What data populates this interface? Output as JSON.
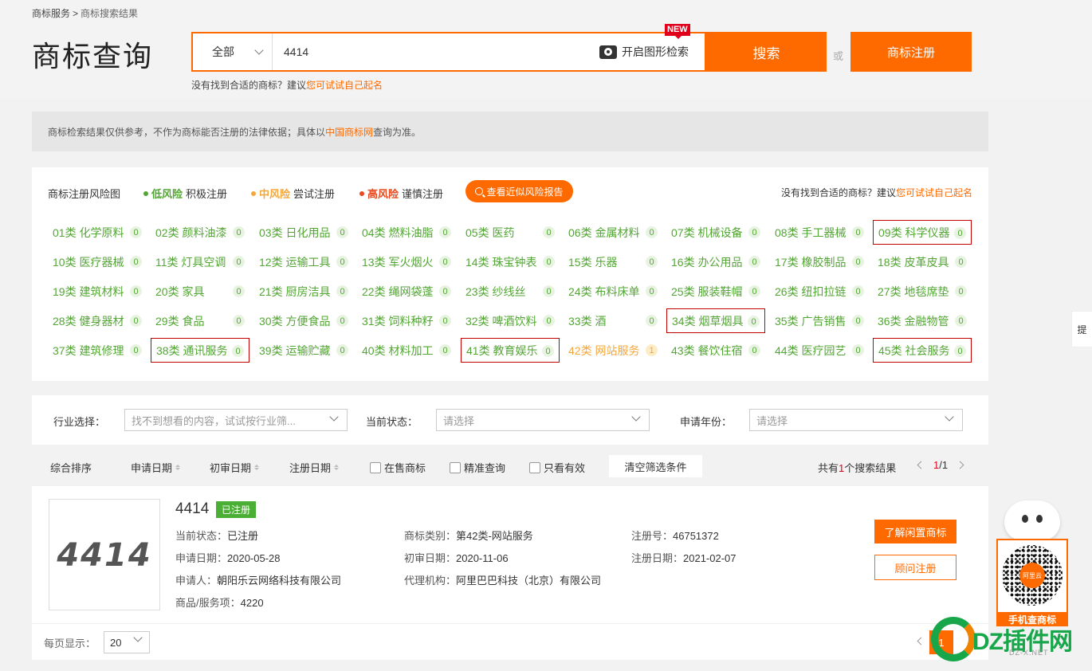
{
  "breadcrumb": {
    "root": "商标服务",
    "sep": ">",
    "current": "商标搜索结果"
  },
  "page_title": "商标查询",
  "search": {
    "scope": "全部",
    "query": "4414",
    "image_search_label": "开启图形检索",
    "new_badge": "NEW",
    "search_button": "搜索",
    "or_text": "或",
    "register_button": "商标注册"
  },
  "suggest": {
    "prefix": "没有找到合适的商标？建议",
    "link": "您可试试自己起名"
  },
  "notice": {
    "text1": "商标检索结果仅供参考，不作为商标能否注册的法律依据；具体以",
    "link": "中国商标网",
    "text2": "查询为准。"
  },
  "risk": {
    "title": "商标注册风险图",
    "low_label": "低风险",
    "low_desc": "积极注册",
    "mid_label": "中风险",
    "mid_desc": "尝试注册",
    "high_label": "高风险",
    "high_desc": "谨慎注册",
    "report_button": "查看近似风险报告",
    "suggest_prefix": "没有找到合适的商标？建议",
    "suggest_link": "您可试试自己起名",
    "colors": {
      "low": "#52a633",
      "mid": "#f3a73d",
      "high": "#e8491d"
    }
  },
  "classes": [
    {
      "label": "01类 化学原料",
      "count": "0"
    },
    {
      "label": "02类 颜料油漆",
      "count": "0"
    },
    {
      "label": "03类 日化用品",
      "count": "0"
    },
    {
      "label": "04类 燃料油脂",
      "count": "0"
    },
    {
      "label": "05类 医药",
      "count": "0"
    },
    {
      "label": "06类 金属材料",
      "count": "0"
    },
    {
      "label": "07类 机械设备",
      "count": "0"
    },
    {
      "label": "08类 手工器械",
      "count": "0"
    },
    {
      "label": "09类 科学仪器",
      "count": "0"
    },
    {
      "label": "10类 医疗器械",
      "count": "0"
    },
    {
      "label": "11类 灯具空调",
      "count": "0"
    },
    {
      "label": "12类 运输工具",
      "count": "0"
    },
    {
      "label": "13类 军火烟火",
      "count": "0"
    },
    {
      "label": "14类 珠宝钟表",
      "count": "0"
    },
    {
      "label": "15类 乐器",
      "count": "0"
    },
    {
      "label": "16类 办公用品",
      "count": "0"
    },
    {
      "label": "17类 橡胶制品",
      "count": "0"
    },
    {
      "label": "18类 皮革皮具",
      "count": "0"
    },
    {
      "label": "19类 建筑材料",
      "count": "0"
    },
    {
      "label": "20类 家具",
      "count": "0"
    },
    {
      "label": "21类 厨房洁具",
      "count": "0"
    },
    {
      "label": "22类 绳网袋蓬",
      "count": "0"
    },
    {
      "label": "23类 纱线丝",
      "count": "0"
    },
    {
      "label": "24类 布料床单",
      "count": "0"
    },
    {
      "label": "25类 服装鞋帽",
      "count": "0"
    },
    {
      "label": "26类 纽扣拉链",
      "count": "0"
    },
    {
      "label": "27类 地毯席垫",
      "count": "0"
    },
    {
      "label": "28类 健身器材",
      "count": "0"
    },
    {
      "label": "29类 食品",
      "count": "0"
    },
    {
      "label": "30类 方便食品",
      "count": "0"
    },
    {
      "label": "31类 饲料种籽",
      "count": "0"
    },
    {
      "label": "32类 啤酒饮料",
      "count": "0"
    },
    {
      "label": "33类 酒",
      "count": "0"
    },
    {
      "label": "34类 烟草烟具",
      "count": "0"
    },
    {
      "label": "35类 广告销售",
      "count": "0"
    },
    {
      "label": "36类 金融物管",
      "count": "0"
    },
    {
      "label": "37类 建筑修理",
      "count": "0"
    },
    {
      "label": "38类 通讯服务",
      "count": "0"
    },
    {
      "label": "39类 运输贮藏",
      "count": "0"
    },
    {
      "label": "40类 材料加工",
      "count": "0"
    },
    {
      "label": "41类 教育娱乐",
      "count": "0"
    },
    {
      "label": "42类 网站服务",
      "count": "1"
    },
    {
      "label": "43类 餐饮住宿",
      "count": "0"
    },
    {
      "label": "44类 医疗园艺",
      "count": "0"
    },
    {
      "label": "45类 社会服务",
      "count": "0"
    }
  ],
  "filters": {
    "industry_label": "行业选择：",
    "industry_placeholder": "找不到想看的内容，试试按行业筛...",
    "status_label": "当前状态：",
    "status_placeholder": "请选择",
    "year_label": "申请年份：",
    "year_placeholder": "请选择"
  },
  "sort": {
    "overall": "综合排序",
    "apply_date": "申请日期",
    "prelim_date": "初审日期",
    "reg_date": "注册日期",
    "on_sale": "在售商标",
    "exact": "精准查询",
    "valid_only": "只看有效",
    "clear": "清空筛选条件",
    "count_prefix": "共有",
    "count_num": "1",
    "count_suffix": "个搜索结果",
    "page_cur": "1",
    "page_total": "/1"
  },
  "result": {
    "logo_text": "4414",
    "name": "4414",
    "status_tag": "已注册",
    "status_label": "当前状态：",
    "status_value": "已注册",
    "class_label": "商标类别：",
    "class_value": "第42类-网站服务",
    "reg_no_label": "注册号：",
    "reg_no_value": "46751372",
    "apply_date_label": "申请日期：",
    "apply_date_value": "2020-05-28",
    "prelim_label": "初审日期：",
    "prelim_value": "2020-11-06",
    "reg_date_label": "注册日期：",
    "reg_date_value": "2021-02-07",
    "applicant_label": "申请人：",
    "applicant_value": "朝阳乐云网络科技有限公司",
    "agent_label": "代理机构：",
    "agent_value": "阿里巴巴科技（北京）有限公司",
    "goods_label": "商品/服务项：",
    "goods_value": "4220",
    "idle_button": "了解闲置商标",
    "consult_button": "顾问注册"
  },
  "footer": {
    "per_page_label": "每页显示：",
    "per_page_value": "20",
    "page_cur": "1"
  },
  "side": {
    "tab_text": "提",
    "qr_label": "手机查商标",
    "qr_center": "阿里云"
  },
  "watermark": {
    "text": "DZ插件网",
    "url": "DZ-X.NET"
  }
}
